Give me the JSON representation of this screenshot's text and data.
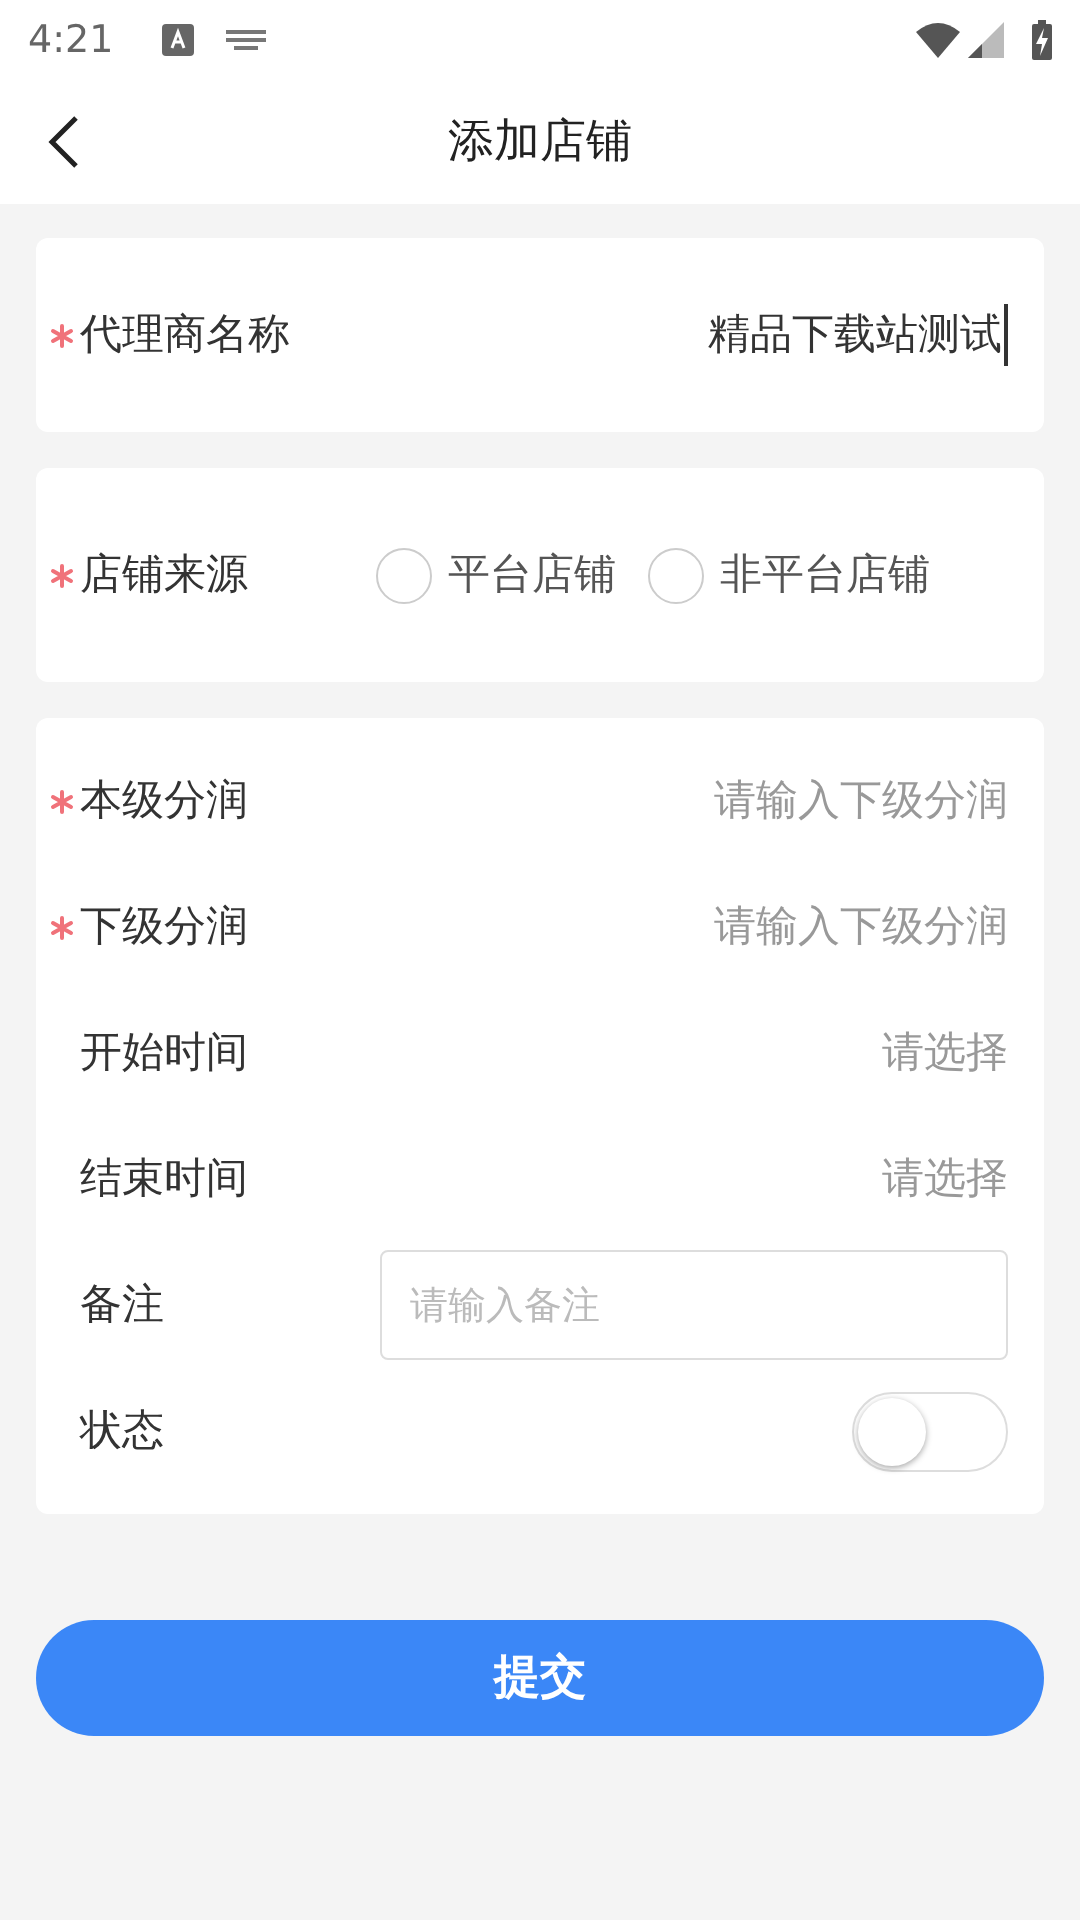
{
  "status_bar": {
    "time": "4:21"
  },
  "header": {
    "title": "添加店铺"
  },
  "cards": [
    {
      "rows": [
        {
          "kind": "text",
          "label": "代理商名称",
          "required": true,
          "value": "精品下载站测试"
        }
      ]
    },
    {
      "rows": [
        {
          "kind": "radio",
          "label": "店铺来源",
          "required": true,
          "options": [
            {
              "label": "平台店铺",
              "selected": false
            },
            {
              "label": "非平台店铺",
              "selected": false
            }
          ]
        }
      ]
    },
    {
      "rows": [
        {
          "kind": "input",
          "label": "本级分润",
          "required": true,
          "placeholder": "请输入下级分润"
        },
        {
          "kind": "input",
          "label": "下级分润",
          "required": true,
          "placeholder": "请输入下级分润"
        },
        {
          "kind": "select",
          "label": "开始时间",
          "required": false,
          "placeholder": "请选择"
        },
        {
          "kind": "select",
          "label": "结束时间",
          "required": false,
          "placeholder": "请选择"
        },
        {
          "kind": "textarea",
          "label": "备注",
          "required": false,
          "placeholder": "请输入备注"
        },
        {
          "kind": "switch",
          "label": "状态",
          "required": false,
          "on": false
        }
      ]
    }
  ],
  "submit": {
    "label": "提交"
  }
}
